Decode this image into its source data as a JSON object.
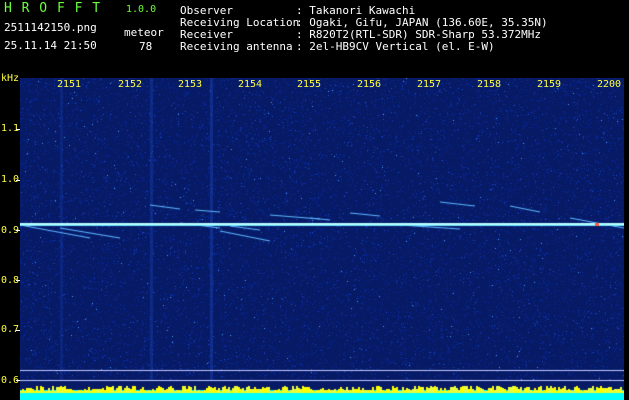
{
  "header": {
    "app_name": "H R O F F T",
    "version": "1.0.0",
    "filename": "2511142150.png",
    "datetime": "25.11.14 21:50",
    "mode_label": "meteor",
    "count": "78",
    "info": [
      {
        "label": "Observer",
        "value": ": Takanori Kawachi"
      },
      {
        "label": "Receiving Location",
        "value": ": Ogaki, Gifu, JAPAN (136.60E, 35.35N)"
      },
      {
        "label": "Receiver",
        "value": ": R820T2(RTL-SDR) SDR-Sharp 53.372MHz"
      },
      {
        "label": "Receiving antenna",
        "value": ": 2el-HB9CV Vertical (el. E-W)"
      }
    ]
  },
  "axes": {
    "y_unit": "kHz",
    "y_ticks": [
      "1.1",
      "1.0",
      "0.9",
      "0.8",
      "0.7",
      "0.6"
    ],
    "x_ticks": [
      "2151",
      "2152",
      "2153",
      "2154",
      "2155",
      "2156",
      "2157",
      "2158",
      "2159",
      "2200"
    ]
  },
  "colors": {
    "background": "#061a66",
    "carrier": "#b8ffff",
    "bottom_band": "#00ffff",
    "label": "#ffff40",
    "title": "#6cff3c"
  }
}
